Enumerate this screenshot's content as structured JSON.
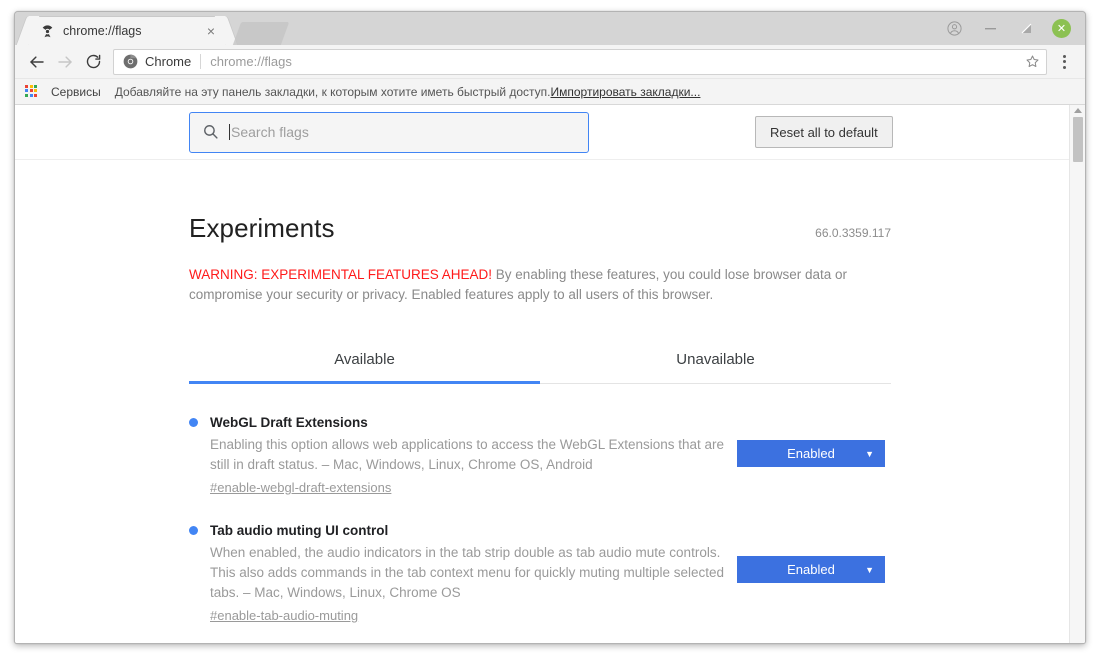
{
  "window": {
    "tab": {
      "favicon": "radioactive-flags-icon",
      "title": "chrome://flags",
      "close_label": "×"
    },
    "controls": {
      "avatar": "avatar-icon",
      "minimize": "–",
      "maximize": "maximize-icon",
      "close": "✕"
    }
  },
  "toolbar": {
    "back": "←",
    "forward": "→",
    "reload": "reload-icon",
    "omnibox": {
      "scheme_label": "Chrome",
      "url": "chrome://flags",
      "star": "star-icon"
    },
    "menu": "three-dot-menu"
  },
  "bookmarks": {
    "apps_label": "apps-grid-icon",
    "services": "Сервисы",
    "hint": "Добавляйте на эту панель закладки, к которым хотите иметь быстрый доступ.",
    "import_link": "Импортировать закладки..."
  },
  "search": {
    "value": "",
    "placeholder": "Search flags",
    "icon": "search-icon"
  },
  "reset_button": {
    "label": "Reset all to default"
  },
  "page": {
    "title": "Experiments",
    "version": "66.0.3359.117",
    "warning_prefix": "WARNING: EXPERIMENTAL FEATURES AHEAD!",
    "warning_body": " By enabling these features, you could lose browser data or compromise your security or privacy. Enabled features apply to all users of this browser."
  },
  "tabs": [
    {
      "label": "Available",
      "active": true
    },
    {
      "label": "Unavailable",
      "active": false
    }
  ],
  "flags": [
    {
      "title": "WebGL Draft Extensions",
      "description": "Enabling this option allows web applications to access the WebGL Extensions that are still in draft status. – Mac, Windows, Linux, Chrome OS, Android",
      "hash": "#enable-webgl-draft-extensions",
      "state": "Enabled",
      "arrow": "▼"
    },
    {
      "title": "Tab audio muting UI control",
      "description": "When enabled, the audio indicators in the tab strip double as tab audio mute controls. This also adds commands in the tab context menu for quickly muting multiple selected tabs. – Mac, Windows, Linux, Chrome OS",
      "hash": "#enable-tab-audio-muting",
      "state": "Enabled",
      "arrow": "▼"
    }
  ],
  "colors": {
    "accent": "#4285f4",
    "select_blue": "#3c71e0",
    "warning_red": "#ff1a1a",
    "close_green": "#8cc152"
  }
}
